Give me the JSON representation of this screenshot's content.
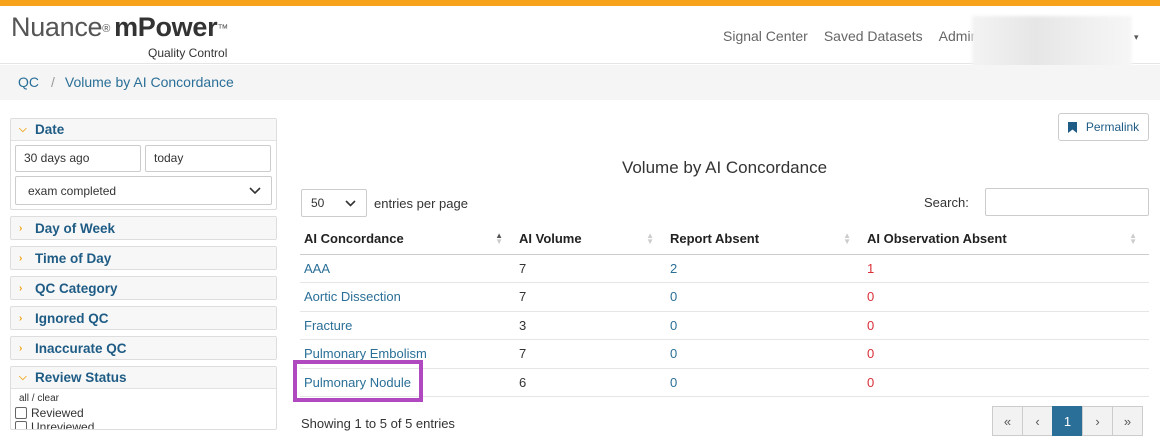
{
  "brand": {
    "name_light": "Nuance",
    "name_bold": "mPower",
    "tm": "™",
    "reg": "®",
    "subtitle": "Quality Control",
    "accent_color": "#f7a21b"
  },
  "nav": {
    "items": [
      "Signal Center",
      "Saved Datasets",
      "Admin"
    ],
    "user_caret": "▾"
  },
  "breadcrumb": {
    "root": "QC",
    "separator": "/",
    "current": "Volume by AI Concordance"
  },
  "filters": {
    "date": {
      "label": "Date",
      "from": "30 days ago",
      "to": "today",
      "type": "exam completed"
    },
    "collapsed_panels": [
      "Day of Week",
      "Time of Day",
      "QC Category",
      "Ignored QC",
      "Inaccurate QC"
    ],
    "review_status": {
      "label": "Review Status",
      "all_clear": "all / clear",
      "options": [
        "Reviewed",
        "Unreviewed"
      ]
    }
  },
  "main": {
    "permalink_label": "Permalink",
    "title": "Volume by AI Concordance",
    "page_length": "50",
    "entries_label": "entries per page",
    "search_label": "Search:",
    "search_value": "",
    "columns": [
      "AI Concordance",
      "AI Volume",
      "Report Absent",
      "AI Observation Absent"
    ],
    "rows": [
      {
        "concordance": "AAA",
        "ai_volume": "7",
        "report_absent": "2",
        "observation_absent": "1"
      },
      {
        "concordance": "Aortic Dissection",
        "ai_volume": "7",
        "report_absent": "0",
        "observation_absent": "0"
      },
      {
        "concordance": "Fracture",
        "ai_volume": "3",
        "report_absent": "0",
        "observation_absent": "0"
      },
      {
        "concordance": "Pulmonary Embolism",
        "ai_volume": "7",
        "report_absent": "0",
        "observation_absent": "0"
      },
      {
        "concordance": "Pulmonary Nodule",
        "ai_volume": "6",
        "report_absent": "0",
        "observation_absent": "0"
      }
    ],
    "showing_text": "Showing 1 to 5 of 5 entries",
    "pager": {
      "first": "«",
      "prev": "‹",
      "current": "1",
      "next": "›",
      "last": "»"
    }
  }
}
